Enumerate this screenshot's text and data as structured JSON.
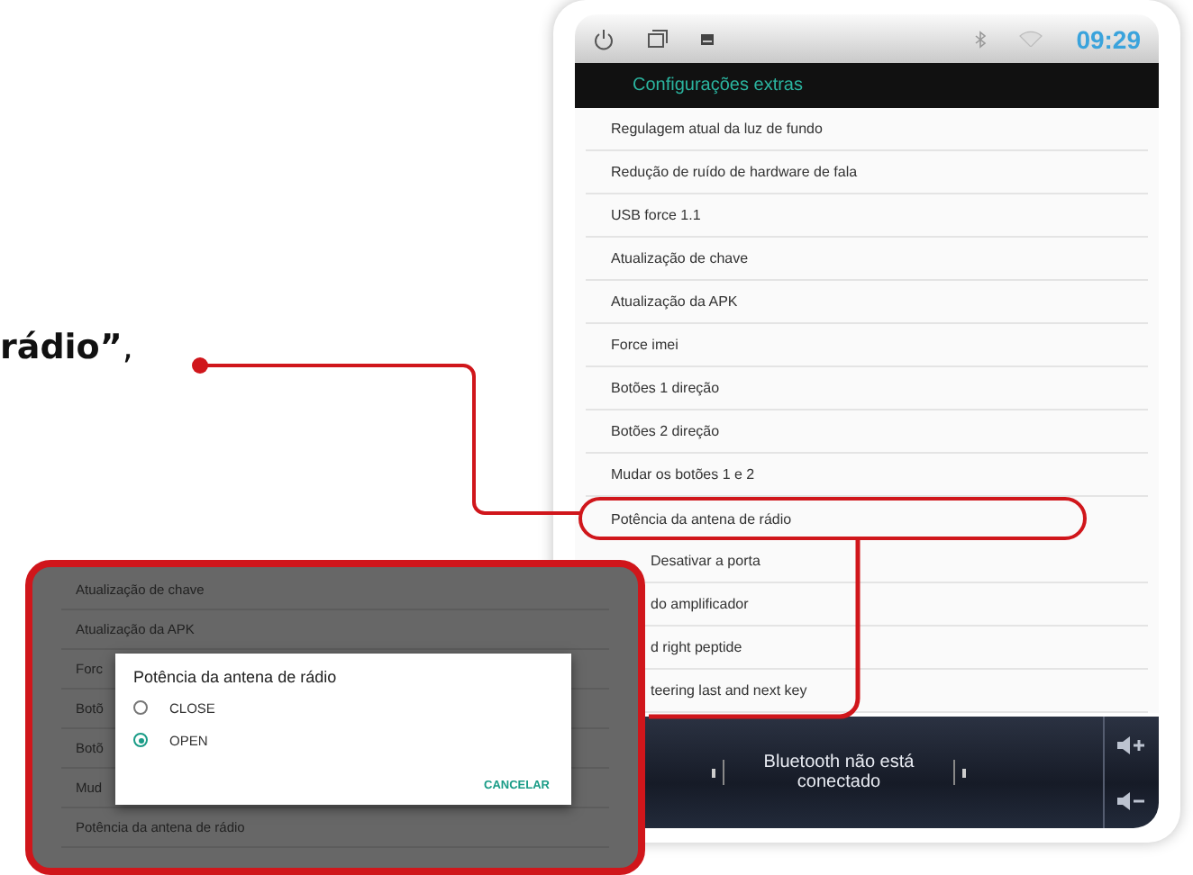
{
  "caption": "**rádio”**,",
  "device": {
    "status_bar": {
      "time": "09:29"
    },
    "title": "Configurações extras",
    "settings": [
      {
        "label": "Regulagem atual da luz de fundo",
        "highlighted": false,
        "covered": false
      },
      {
        "label": "Redução de ruído de hardware de fala",
        "highlighted": false,
        "covered": false
      },
      {
        "label": "USB force 1.1",
        "highlighted": false,
        "covered": false
      },
      {
        "label": "Atualização de chave",
        "highlighted": false,
        "covered": false
      },
      {
        "label": "Atualização da APK",
        "highlighted": false,
        "covered": false
      },
      {
        "label": "Force imei",
        "highlighted": false,
        "covered": false
      },
      {
        "label": "Botões 1 direção",
        "highlighted": false,
        "covered": false
      },
      {
        "label": "Botões 2 direção",
        "highlighted": false,
        "covered": false
      },
      {
        "label": "Mudar os botões 1 e 2",
        "highlighted": false,
        "covered": false
      },
      {
        "label": "Potência da antena de rádio",
        "highlighted": true,
        "covered": false
      },
      {
        "label": "Desativar a porta",
        "highlighted": false,
        "covered": true
      },
      {
        "label": "do amplificador",
        "highlighted": false,
        "covered": true
      },
      {
        "label": "d right peptide",
        "highlighted": false,
        "covered": true
      },
      {
        "label": "teering last and next key",
        "highlighted": false,
        "covered": true
      }
    ],
    "media_bar": {
      "message": "Bluetooth não está conectado"
    }
  },
  "inset": {
    "rows": [
      {
        "label": "Atualização de chave"
      },
      {
        "label": "Atualização da APK"
      },
      {
        "label": "Forc"
      },
      {
        "label": "Botõ"
      },
      {
        "label": "Botõ"
      },
      {
        "label": "Mud"
      },
      {
        "label": "Potência da antena de rádio"
      }
    ],
    "dialog": {
      "title": "Potência da antena de rádio",
      "options": [
        {
          "label": "CLOSE",
          "selected": false
        },
        {
          "label": "OPEN",
          "selected": true
        }
      ],
      "cancel": "CANCELAR"
    }
  }
}
